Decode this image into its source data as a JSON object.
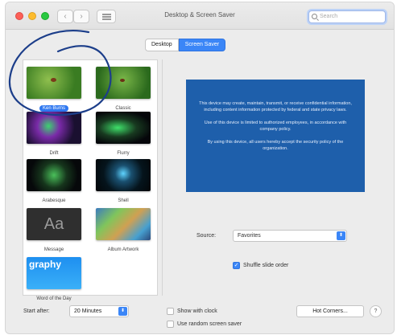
{
  "window": {
    "title": "Desktop & Screen Saver"
  },
  "toolbar": {
    "back": "‹",
    "forward": "›",
    "search_placeholder": "Search"
  },
  "tabs": [
    {
      "label": "Desktop",
      "selected": false
    },
    {
      "label": "Screen Saver",
      "selected": true
    }
  ],
  "savers": [
    {
      "name": "Ken Burns",
      "selected": true
    },
    {
      "name": "Classic"
    },
    {
      "name": "Drift"
    },
    {
      "name": "Flurry"
    },
    {
      "name": "Arabesque"
    },
    {
      "name": "Shell"
    },
    {
      "name": "Message",
      "thumb_text": "Aa"
    },
    {
      "name": "Album Artwork"
    },
    {
      "name": "Word of the Day",
      "thumb_text": "graphy"
    }
  ],
  "preview": {
    "paragraphs": [
      "This device may create, maintain, transmit, or receive confidential information, including content information protected by federal and state privacy laws.",
      "Use of this device is limited to authorized employees, in accordance with company policy.",
      "By using this device, all users hereby accept the security policy of the organization."
    ]
  },
  "source": {
    "label": "Source:",
    "value": "Favorites"
  },
  "shuffle": {
    "label": "Shuffle slide order",
    "checked": true
  },
  "start_after": {
    "label": "Start after:",
    "value": "20 Minutes"
  },
  "show_clock": {
    "label": "Show with clock",
    "checked": false
  },
  "random_saver": {
    "label": "Use random screen saver",
    "checked": false
  },
  "hot_corners": {
    "label": "Hot Corners..."
  },
  "help": {
    "label": "?"
  },
  "colors": {
    "accent": "#3b86f7",
    "preview_bg": "#1e5fab",
    "annotation": "#1c3e8a"
  }
}
